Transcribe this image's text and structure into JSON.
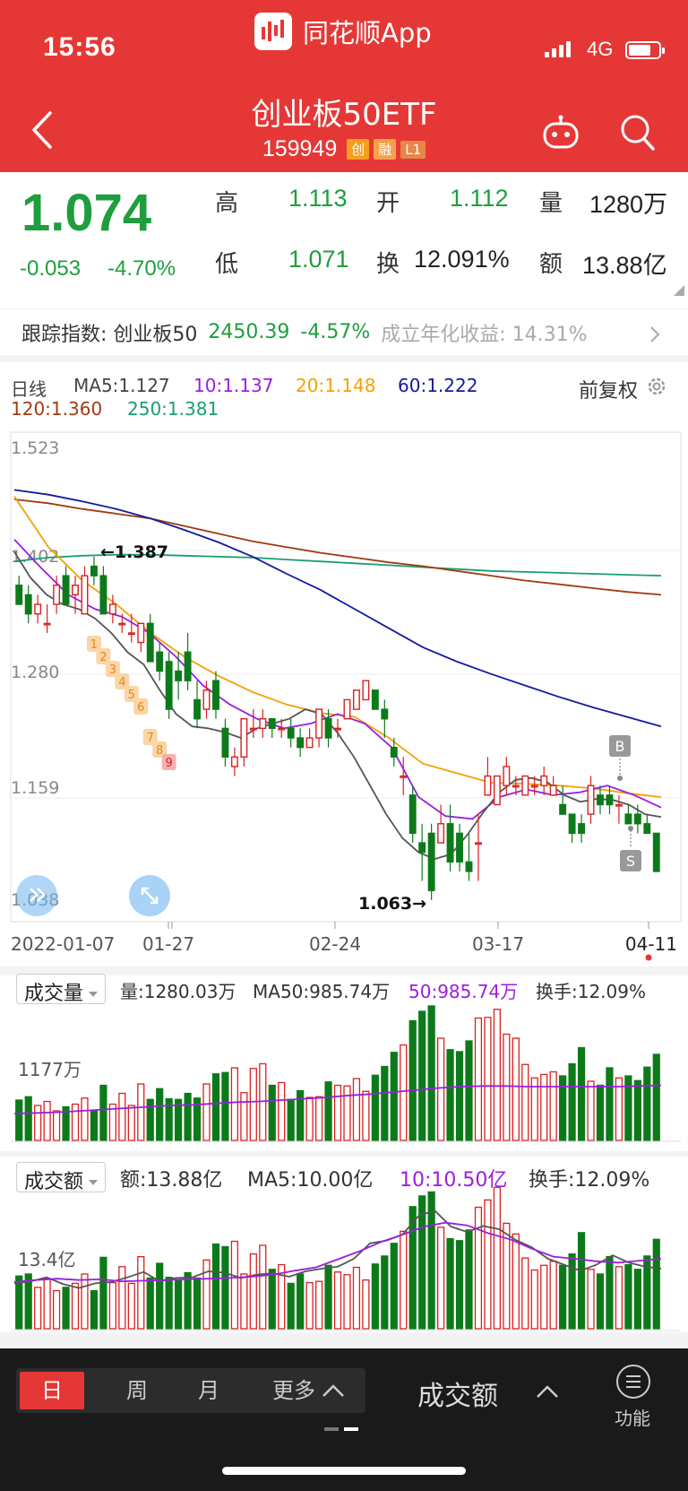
{
  "status_bar": {
    "time": "15:56",
    "network": "4G"
  },
  "header": {
    "app_title": "同花顺App",
    "stock_name": "创业板50ETF",
    "stock_code": "159949",
    "tags": [
      "创",
      "融",
      "L1"
    ]
  },
  "quote": {
    "price": "1.074",
    "change": "-0.053",
    "change_pct": "-4.70%",
    "fields": [
      {
        "label": "高",
        "value": "1.113"
      },
      {
        "label": "开",
        "value": "1.112"
      },
      {
        "label": "量",
        "value": "1280万"
      },
      {
        "label": "低",
        "value": "1.071"
      },
      {
        "label": "换",
        "value": "12.091%"
      },
      {
        "label": "额",
        "value": "13.88亿"
      }
    ]
  },
  "tracking": {
    "label": "跟踪指数: 创业板50",
    "value": "2450.39",
    "change": "-4.57%",
    "annual_label": "成立年化收益: 14.31%"
  },
  "colors": {
    "header_red": "#e53836",
    "rise": "#d92020",
    "fall": "#0d7a1a",
    "ma5": "#555555",
    "ma10": "#9b1ee0",
    "ma20": "#f5a000",
    "ma60": "#141a9c",
    "ma120": "#a23a10",
    "ma250": "#1a9e6e"
  },
  "ma_legend": {
    "period": "日线",
    "ma5": "MA5:1.127",
    "ma10": "10:1.137",
    "ma20": "20:1.148",
    "ma60": "60:1.222",
    "ma120": "120:1.360",
    "ma250": "250:1.381",
    "adjust": "前复权"
  },
  "chart_data": [
    {
      "type": "candlestick",
      "title": "",
      "price_axis_ticks": [
        "1.523",
        "1.402",
        "1.280",
        "1.159",
        "1.038"
      ],
      "ylim": [
        1.038,
        1.523
      ],
      "x_tick_labels": [
        "2022-01-07",
        "01-27",
        "02-24",
        "03-17",
        "04-11"
      ],
      "annotations": [
        "←1.387",
        "1.063→",
        "B",
        "S"
      ],
      "signal_numbers": [
        "1",
        "2",
        "3",
        "4",
        "5",
        "6",
        "7",
        "8",
        "9"
      ],
      "candles": [
        [
          1.37,
          1.38,
          1.35,
          1.35
        ],
        [
          1.36,
          1.37,
          1.33,
          1.34
        ],
        [
          1.34,
          1.36,
          1.33,
          1.35
        ],
        [
          1.33,
          1.35,
          1.32,
          1.33
        ],
        [
          1.35,
          1.38,
          1.34,
          1.37
        ],
        [
          1.38,
          1.39,
          1.35,
          1.35
        ],
        [
          1.36,
          1.38,
          1.34,
          1.37
        ],
        [
          1.34,
          1.39,
          1.34,
          1.38
        ],
        [
          1.39,
          1.4,
          1.37,
          1.38
        ],
        [
          1.38,
          1.39,
          1.34,
          1.34
        ],
        [
          1.34,
          1.36,
          1.33,
          1.35
        ],
        [
          1.33,
          1.34,
          1.32,
          1.33
        ],
        [
          1.32,
          1.34,
          1.31,
          1.32
        ],
        [
          1.31,
          1.33,
          1.3,
          1.33
        ],
        [
          1.33,
          1.34,
          1.29,
          1.29
        ],
        [
          1.3,
          1.31,
          1.27,
          1.28
        ],
        [
          1.29,
          1.3,
          1.23,
          1.24
        ],
        [
          1.28,
          1.3,
          1.25,
          1.27
        ],
        [
          1.3,
          1.32,
          1.26,
          1.27
        ],
        [
          1.25,
          1.27,
          1.22,
          1.23
        ],
        [
          1.24,
          1.27,
          1.23,
          1.26
        ],
        [
          1.27,
          1.28,
          1.23,
          1.24
        ],
        [
          1.22,
          1.23,
          1.18,
          1.19
        ],
        [
          1.18,
          1.2,
          1.17,
          1.19
        ],
        [
          1.19,
          1.23,
          1.18,
          1.23
        ],
        [
          1.22,
          1.24,
          1.21,
          1.22
        ],
        [
          1.22,
          1.24,
          1.21,
          1.23
        ],
        [
          1.23,
          1.23,
          1.21,
          1.22
        ],
        [
          1.22,
          1.23,
          1.21,
          1.22
        ],
        [
          1.22,
          1.23,
          1.2,
          1.21
        ],
        [
          1.21,
          1.22,
          1.19,
          1.2
        ],
        [
          1.2,
          1.22,
          1.2,
          1.21
        ],
        [
          1.21,
          1.24,
          1.2,
          1.24
        ],
        [
          1.23,
          1.24,
          1.2,
          1.21
        ],
        [
          1.22,
          1.23,
          1.21,
          1.22
        ],
        [
          1.23,
          1.25,
          1.23,
          1.25
        ],
        [
          1.24,
          1.26,
          1.24,
          1.26
        ],
        [
          1.25,
          1.27,
          1.25,
          1.27
        ],
        [
          1.26,
          1.26,
          1.24,
          1.24
        ],
        [
          1.24,
          1.25,
          1.21,
          1.23
        ],
        [
          1.2,
          1.21,
          1.18,
          1.19
        ],
        [
          1.17,
          1.19,
          1.15,
          1.17
        ],
        [
          1.15,
          1.16,
          1.1,
          1.11
        ],
        [
          1.1,
          1.12,
          1.06,
          1.09
        ],
        [
          1.11,
          1.12,
          1.04,
          1.05
        ],
        [
          1.1,
          1.14,
          1.1,
          1.12
        ],
        [
          1.12,
          1.14,
          1.07,
          1.08
        ],
        [
          1.11,
          1.12,
          1.07,
          1.08
        ],
        [
          1.08,
          1.11,
          1.06,
          1.07
        ],
        [
          1.1,
          1.13,
          1.06,
          1.1
        ],
        [
          1.15,
          1.19,
          1.15,
          1.17
        ],
        [
          1.14,
          1.17,
          1.14,
          1.17
        ],
        [
          1.16,
          1.19,
          1.15,
          1.18
        ],
        [
          1.16,
          1.17,
          1.15,
          1.16
        ],
        [
          1.15,
          1.17,
          1.15,
          1.17
        ],
        [
          1.16,
          1.17,
          1.15,
          1.16
        ],
        [
          1.16,
          1.18,
          1.15,
          1.17
        ],
        [
          1.15,
          1.17,
          1.15,
          1.16
        ],
        [
          1.14,
          1.16,
          1.13,
          1.13
        ],
        [
          1.13,
          1.13,
          1.1,
          1.11
        ],
        [
          1.12,
          1.13,
          1.1,
          1.11
        ],
        [
          1.13,
          1.17,
          1.12,
          1.16
        ],
        [
          1.15,
          1.16,
          1.13,
          1.14
        ],
        [
          1.15,
          1.16,
          1.13,
          1.14
        ],
        [
          1.14,
          1.15,
          1.12,
          1.14
        ],
        [
          1.13,
          1.14,
          1.12,
          1.12
        ],
        [
          1.13,
          1.14,
          1.11,
          1.12
        ],
        [
          1.12,
          1.13,
          1.11,
          1.11
        ],
        [
          1.11,
          1.11,
          1.07,
          1.07
        ]
      ],
      "series": [
        {
          "name": "250",
          "values": [
            1.395,
            1.399,
            1.401,
            1.402,
            1.402,
            1.401,
            1.4,
            1.399,
            1.397,
            1.395,
            1.393,
            1.391,
            1.389,
            1.387,
            1.385,
            1.384,
            1.383,
            1.382,
            1.381,
            1.38
          ]
        },
        {
          "name": "120",
          "values": [
            1.46,
            1.456,
            1.45,
            1.445,
            1.44,
            1.432,
            1.424,
            1.416,
            1.41,
            1.404,
            1.399,
            1.394,
            1.39,
            1.385,
            1.38,
            1.375,
            1.371,
            1.367,
            1.363,
            1.36
          ]
        },
        {
          "name": "60",
          "values": [
            1.47,
            1.465,
            1.458,
            1.45,
            1.44,
            1.428,
            1.415,
            1.4,
            1.382,
            1.365,
            1.345,
            1.325,
            1.305,
            1.29,
            1.277,
            1.265,
            1.253,
            1.242,
            1.232,
            1.222
          ]
        },
        {
          "name": "20",
          "values": [
            1.463,
            1.41,
            1.375,
            1.35,
            1.32,
            1.295,
            1.275,
            1.258,
            1.245,
            1.236,
            1.232,
            1.21,
            1.183,
            1.173,
            1.163,
            1.162,
            1.16,
            1.157,
            1.152,
            1.148
          ]
        },
        {
          "name": "10",
          "values": [
            1.418,
            1.388,
            1.36,
            1.345,
            1.337,
            1.32,
            1.295,
            1.265,
            1.245,
            1.23,
            1.22,
            1.225,
            1.235,
            1.225,
            1.2,
            1.148,
            1.128,
            1.125,
            1.148,
            1.156,
            1.15,
            1.153,
            1.16,
            1.15,
            1.137
          ]
        },
        {
          "name": "MA5",
          "values": [
            1.405,
            1.378,
            1.36,
            1.35,
            1.345,
            1.335,
            1.32,
            1.3,
            1.287,
            1.26,
            1.235,
            1.222,
            1.22,
            1.216,
            1.21,
            1.22,
            1.225,
            1.23,
            1.24,
            1.235,
            1.215,
            1.19,
            1.16,
            1.13,
            1.105,
            1.09,
            1.083,
            1.088,
            1.108,
            1.132,
            1.153,
            1.166,
            1.168,
            1.163,
            1.15,
            1.143,
            1.146,
            1.145,
            1.14,
            1.13,
            1.127
          ]
        }
      ]
    },
    {
      "type": "bar",
      "title": "成交量",
      "y_tick_labels": [
        "1177万"
      ],
      "values": [
        6,
        6.5,
        5.2,
        5.8,
        4.4,
        5,
        5.4,
        6.3,
        4.4,
        8.2,
        5.4,
        7,
        5.2,
        8.4,
        6.1,
        7.7,
        6.2,
        6.1,
        7,
        6.3,
        8.4,
        9.9,
        10.1,
        10.8,
        7.1,
        10.7,
        11.4,
        8.2,
        8.6,
        6.1,
        7.4,
        6.4,
        6.5,
        8.7,
        8.2,
        8.1,
        9.2,
        7.3,
        9.7,
        11,
        13.1,
        14.2,
        17.8,
        19.2,
        20,
        15.2,
        13.5,
        13.2,
        14.8,
        18.2,
        18.3,
        19.5,
        15.8,
        15.2,
        11.3,
        9.3,
        9.8,
        10.2,
        9.6,
        11.4,
        13.8,
        8.8,
        8.2,
        10.8,
        9.3,
        9.6,
        8.9,
        10.9,
        12.8
      ],
      "series": [
        {
          "name": "MA50",
          "values": [
            4,
            4.1,
            4.2,
            4.4,
            4.6,
            4.8,
            5.0,
            5.2,
            5.3,
            5.5,
            5.7,
            5.8,
            6.0,
            6.2,
            6.4,
            6.7,
            6.9,
            7.2,
            7.5,
            7.8,
            8.0,
            8.1,
            8.1,
            8.0,
            8.0,
            8.0,
            8.0,
            8.0,
            8.1,
            8.2
          ]
        }
      ]
    },
    {
      "type": "bar",
      "title": "成交额",
      "y_tick_labels": [
        "13.4亿"
      ],
      "values": [
        7.9,
        8.2,
        6.2,
        7.5,
        5.7,
        6.2,
        6.8,
        8.2,
        5.7,
        10.7,
        6.9,
        9.3,
        6.8,
        10.8,
        7.6,
        9.8,
        7.7,
        7.2,
        8.4,
        7.6,
        10.3,
        12.7,
        12.3,
        13.1,
        8.2,
        11.2,
        12.5,
        8.9,
        9.6,
        6.8,
        8.2,
        6.9,
        7.1,
        9.5,
        8.5,
        8.1,
        9.2,
        7.3,
        9.7,
        10.9,
        12.8,
        14.6,
        18.3,
        19.9,
        20.5,
        15.2,
        13.5,
        13.2,
        14.8,
        18.2,
        19.3,
        21.2,
        15.8,
        14.2,
        10.6,
        8.8,
        9.5,
        10.1,
        9.5,
        11.2,
        14.4,
        8.9,
        8.2,
        10.8,
        9.3,
        9.6,
        8.9,
        10.9,
        13.4
      ],
      "series": [
        {
          "name": "MA5",
          "values": [
            6.8,
            7.1,
            7.7,
            6.7,
            6.1,
            6.8,
            7.0,
            7.7,
            8.5,
            7.1,
            7.6,
            7.7,
            8.6,
            8.4,
            7.6,
            8.1,
            8.3,
            7.8,
            8.6,
            9.0,
            9.3,
            10.5,
            12.8,
            13.2,
            14.1,
            16.9,
            17.7,
            15.3,
            14.5,
            15.4,
            14.9,
            13.3,
            12.2,
            10.5,
            9.6,
            8.7,
            9.6,
            11.0,
            9.9,
            9.3,
            9.0
          ]
        },
        {
          "name": "10",
          "values": [
            7.0,
            7.3,
            7.5,
            7.3,
            7.4,
            7.1,
            7.2,
            7.3,
            7.4,
            7.5,
            7.6,
            7.8,
            8.1,
            8.7,
            9.2,
            10.4,
            11.6,
            13.0,
            14.1,
            15.3,
            15.9,
            15.5,
            14.3,
            13.4,
            12.0,
            10.8,
            10.5,
            10.1,
            9.9,
            10.2,
            10.5
          ]
        }
      ]
    }
  ],
  "volume_panel": {
    "selector": "成交量",
    "vol": "量:1280.03万",
    "ma50": "MA50:985.74万",
    "ma50b": "50:985.74万",
    "turnover": "换手:12.09%",
    "axis": "1177万"
  },
  "amount_panel": {
    "selector": "成交额",
    "amt": "额:13.88亿",
    "ma5": "MA5:10.00亿",
    "ma10": "10:10.50亿",
    "turnover": "换手:12.09%",
    "axis": "13.4亿"
  },
  "bottom_bar": {
    "tabs": [
      "日",
      "周",
      "月",
      "更多"
    ],
    "indicator": "成交额",
    "function_label": "功能"
  }
}
